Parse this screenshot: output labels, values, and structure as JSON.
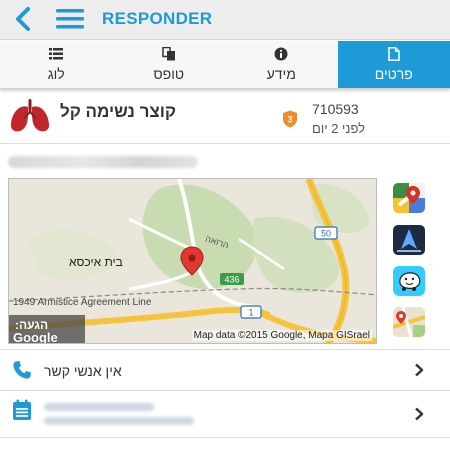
{
  "appbar": {
    "title": "RESPONDER"
  },
  "tabs": [
    {
      "label": "לוג",
      "icon": "list-icon"
    },
    {
      "label": "טופס",
      "icon": "copy-icon"
    },
    {
      "label": "מידע",
      "icon": "info-icon"
    },
    {
      "label": "פרטים",
      "icon": "document-icon",
      "active": true
    }
  ],
  "incident": {
    "title": "קוצר נשימה קל",
    "id": "710593",
    "time": "לפני 2 יום",
    "priority": "3"
  },
  "map": {
    "place": "בית איכסא",
    "street": "הרואה",
    "armistice": "1949 Armistice Agreement Line",
    "road_a": "50",
    "road_b": "436",
    "road_c": "1",
    "google": "Google",
    "attribution": "Map data ©2015 Google, Mapa GISrael",
    "arrival_label": "הגעה:"
  },
  "nav_apps": [
    "google-maps-icon",
    "navigation-app-icon",
    "waze-icon",
    "maps-app-icon"
  ],
  "contacts": {
    "label": "אין אנשי קשר"
  },
  "colors": {
    "accent": "#1e9ad6",
    "lungs": "#c0272d",
    "shield": "#f08b25"
  }
}
